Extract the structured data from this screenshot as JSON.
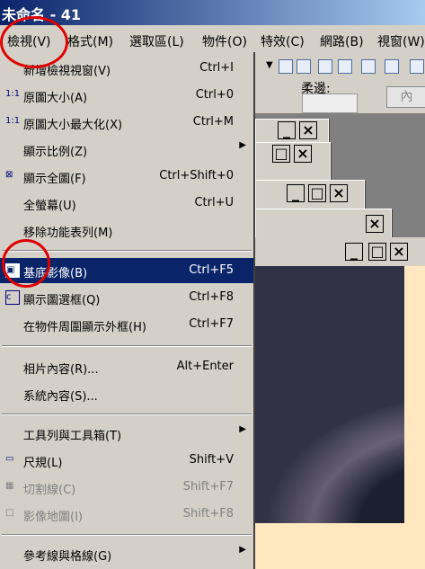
{
  "window": {
    "title": "未命名 - 41"
  },
  "menubar": {
    "items": [
      "檢視(V)",
      "格式(M)",
      "選取區(L)",
      "物件(O)",
      "特效(C)",
      "網路(B)",
      "視窗(W)"
    ]
  },
  "options": {
    "soft_edge_label": "柔邊:",
    "apply_label": "內"
  },
  "view_menu": {
    "items": [
      {
        "label": "新增檢視視窗(V)",
        "shortcut": "Ctrl+I",
        "icon": ""
      },
      {
        "label": "原圖大小(A)",
        "shortcut": "Ctrl+0",
        "icon": "1:1"
      },
      {
        "label": "原圖大小最大化(X)",
        "shortcut": "Ctrl+M",
        "icon": "1:1"
      },
      {
        "label": "顯示比例(Z)",
        "shortcut": "",
        "icon": ""
      },
      {
        "label": "顯示全圖(F)",
        "shortcut": "Ctrl+Shift+0",
        "icon": "⊠"
      },
      {
        "label": "全螢幕(U)",
        "shortcut": "Ctrl+U",
        "icon": ""
      },
      {
        "label": "移除功能表列(M)",
        "shortcut": "",
        "icon": ""
      },
      {
        "label": "基底影像(B)",
        "shortcut": "Ctrl+F5",
        "icon": ""
      },
      {
        "label": "顯示圖選框(Q)",
        "shortcut": "Ctrl+F8",
        "icon": ""
      },
      {
        "label": "在物件周圍顯示外框(H)",
        "shortcut": "Ctrl+F7",
        "icon": ""
      },
      {
        "label": "相片內容(R)...",
        "shortcut": "Alt+Enter",
        "icon": ""
      },
      {
        "label": "系統內容(S)...",
        "shortcut": "",
        "icon": ""
      },
      {
        "label": "工具列與工具箱(T)",
        "shortcut": "",
        "icon": ""
      },
      {
        "label": "尺規(L)",
        "shortcut": "Shift+V",
        "icon": ""
      },
      {
        "label": "切割線(C)",
        "shortcut": "Shift+F7",
        "icon": ""
      },
      {
        "label": "影像地圖(I)",
        "shortcut": "Shift+F8",
        "icon": ""
      },
      {
        "label": "參考線與格線(G)",
        "shortcut": "",
        "icon": ""
      }
    ]
  },
  "colors": {
    "selection": "#0a246a",
    "highlight_circle": "#e00000"
  }
}
